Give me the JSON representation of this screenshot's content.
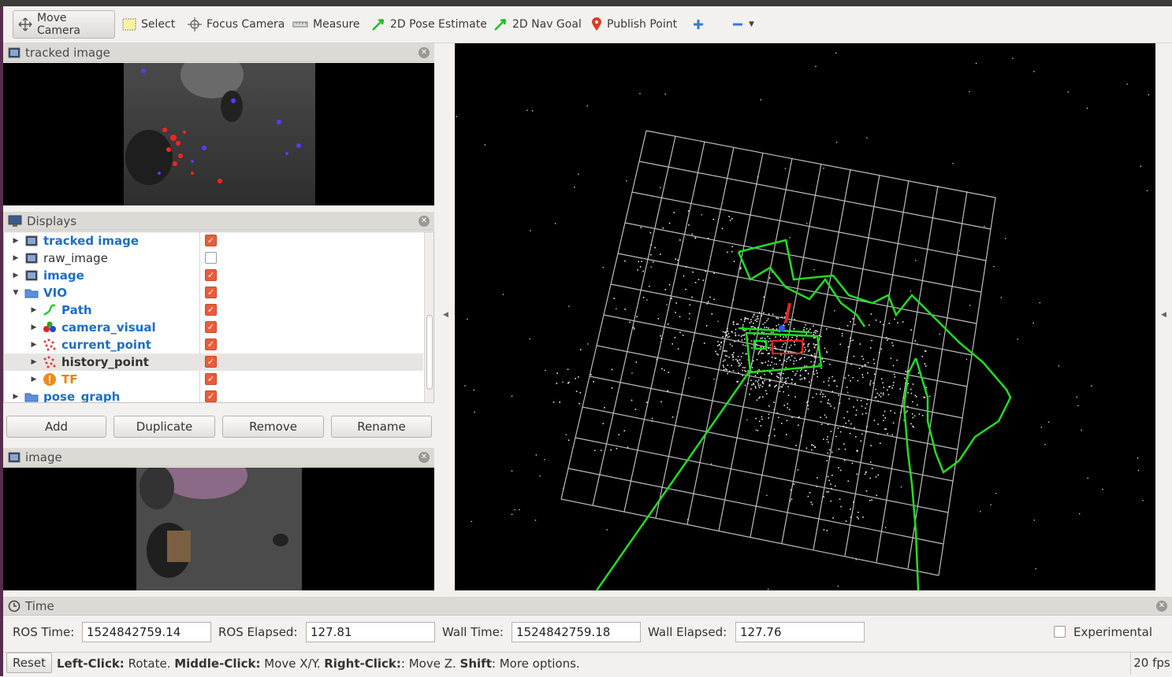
{
  "toolbar": {
    "move_camera": "Move Camera",
    "select": "Select",
    "focus_camera": "Focus Camera",
    "measure": "Measure",
    "pose_estimate": "2D Pose Estimate",
    "nav_goal": "2D Nav Goal",
    "publish_point": "Publish Point"
  },
  "panels": {
    "tracked_image_title": "tracked image",
    "displays_title": "Displays",
    "image_title": "image",
    "time_title": "Time"
  },
  "displays": {
    "items": [
      {
        "label": "tracked image",
        "checked": true
      },
      {
        "label": "raw_image",
        "checked": false
      },
      {
        "label": "image",
        "checked": true
      },
      {
        "label": "VIO",
        "checked": true
      },
      {
        "label": "Path",
        "checked": true
      },
      {
        "label": "camera_visual",
        "checked": true
      },
      {
        "label": "current_point",
        "checked": true
      },
      {
        "label": "history_point",
        "checked": true
      },
      {
        "label": "TF",
        "checked": true
      },
      {
        "label": "pose_graph",
        "checked": true
      }
    ],
    "buttons": {
      "add": "Add",
      "duplicate": "Duplicate",
      "remove": "Remove",
      "rename": "Rename"
    }
  },
  "time": {
    "ros_time_label": "ROS Time:",
    "ros_time": "1524842759.14",
    "ros_elapsed_label": "ROS Elapsed:",
    "ros_elapsed": "127.81",
    "wall_time_label": "Wall Time:",
    "wall_time": "1524842759.18",
    "wall_elapsed_label": "Wall Elapsed:",
    "wall_elapsed": "127.76",
    "experimental_label": "Experimental"
  },
  "status": {
    "reset": "Reset",
    "k1": "Left-Click:",
    "v1": " Rotate. ",
    "k2": "Middle-Click:",
    "v2": " Move X/Y. ",
    "k3": "Right-Click:",
    "v3": ": Move Z. ",
    "k4": "Shift",
    "v4": ": More options.",
    "fps": "20 fps"
  },
  "colors": {
    "path": "#22dd22",
    "checked": "#e95d3b",
    "link": "#1c6ec7"
  }
}
